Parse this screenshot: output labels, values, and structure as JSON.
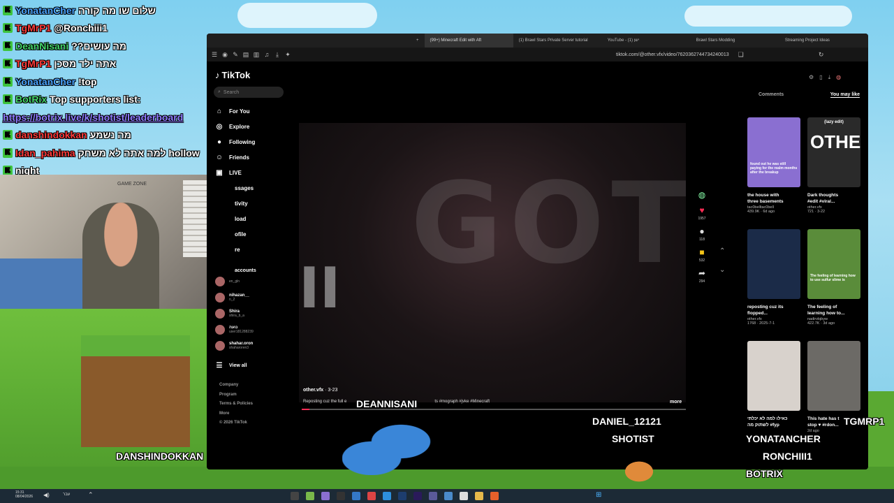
{
  "chat": [
    {
      "user": "YonatanCher",
      "user_color": "#4aa3ff",
      "msg": "שלום שו מה קורה",
      "link": ""
    },
    {
      "user": "TgMrP1",
      "user_color": "#ff3b3b",
      "msg": "@Ronchiii1",
      "link": ""
    },
    {
      "user": "DeanNisani",
      "user_color": "#44d46a",
      "msg": "??מה עושים",
      "link": ""
    },
    {
      "user": "TgMrP1",
      "user_color": "#ff3b3b",
      "msg": "אתה ילד מסכן",
      "link": ""
    },
    {
      "user": "YonatanCher",
      "user_color": "#4aa3ff",
      "msg": "!top",
      "link": ""
    },
    {
      "user": "BotRix",
      "user_color": "#44d46a",
      "msg": "Top supporters list:",
      "link": ""
    },
    {
      "user": "",
      "user_color": "#8f7cff",
      "msg": "",
      "link": "https://botrix.live/k/shotist/leaderboard"
    },
    {
      "user": "danshindokkan",
      "user_color": "#ff3b3b",
      "msg": "מה נשמע",
      "link": ""
    },
    {
      "user": "Idan_pahima",
      "user_color": "#ff3b3b",
      "msg": "למה אתה לא משחק hollow",
      "link": ""
    },
    {
      "user": "night",
      "user_color": "#ffffff",
      "msg": "",
      "link": ""
    }
  ],
  "webcam": {
    "wall_sign": "GAME ZONE"
  },
  "browser": {
    "tabs": [
      {
        "label": "(99+) Minecraft Edit with Aft",
        "active": true
      },
      {
        "label": "(1) Brawl Stars Private Server tutorial",
        "active": false
      },
      {
        "label": "YouTube - ישן (1)",
        "active": false
      },
      {
        "label": "Brawl Stars Modding",
        "active": false
      },
      {
        "label": "Streaming Project Ideas",
        "active": false
      }
    ],
    "url": "tiktok.com/@other.vfx/video/7620362744734240013"
  },
  "tiktok": {
    "logo": "TikTok",
    "search_placeholder": "Search",
    "nav": [
      {
        "label": "For You",
        "icon": "home-icon",
        "glyph": "⌂"
      },
      {
        "label": "Explore",
        "icon": "compass-icon",
        "glyph": "◎"
      },
      {
        "label": "Following",
        "icon": "following-icon",
        "glyph": "●"
      },
      {
        "label": "Friends",
        "icon": "friends-icon",
        "glyph": "☺"
      },
      {
        "label": "LIVE",
        "icon": "live-icon",
        "glyph": "▣"
      },
      {
        "label": "ssages",
        "icon": "messages-icon",
        "glyph": ""
      },
      {
        "label": "tivity",
        "icon": "activity-icon",
        "glyph": ""
      },
      {
        "label": "load",
        "icon": "upload-icon",
        "glyph": ""
      },
      {
        "label": "ofile",
        "icon": "profile-icon",
        "glyph": ""
      },
      {
        "label": "re",
        "icon": "more-icon",
        "glyph": ""
      }
    ],
    "following_accounts_header": "accounts",
    "accounts": [
      {
        "name": "",
        "handle": "en_gln"
      },
      {
        "name": "nihazan__",
        "handle": "n_2"
      },
      {
        "name": "Shira",
        "handle": "shira_b_a"
      },
      {
        "name": "נועה",
        "handle": "user181288239"
      },
      {
        "name": "shahar.oron",
        "handle": "shaharoren3"
      }
    ],
    "view_all": "View all",
    "footer": [
      "Company",
      "Program",
      "Terms & Policies",
      "More",
      "© 2026 TikTok"
    ],
    "video": {
      "author": "other.vfx",
      "date": "3-23",
      "caption_start": "Reposting cuz the full e",
      "caption_end": "ts #mograph #jvke #Minecraft",
      "more": "more",
      "big_text": "GOT",
      "side_text": "II",
      "progress": 0.02
    },
    "actions": [
      {
        "icon": "like-icon",
        "glyph": "♥",
        "count": "1957",
        "color": "#fe2c55"
      },
      {
        "icon": "comment-icon",
        "glyph": "●",
        "count": "118",
        "color": "#dddddd"
      },
      {
        "icon": "bookmark-icon",
        "glyph": "■",
        "count": "532",
        "color": "#f5c518"
      },
      {
        "icon": "share-icon",
        "glyph": "➦",
        "count": "294",
        "color": "#dddddd"
      }
    ],
    "right_tabs": [
      "Comments",
      "You may like"
    ],
    "cards": [
      {
        "title": "the house with\nthree basements",
        "author": "tac0belltac0bell",
        "stats": "439.9K · 6d ago",
        "thumb_text": "found out he was still paying for the realm months after the breakup",
        "bg": "#8a6fd1"
      },
      {
        "title": "Dark thoughts\n#edit #viral...",
        "author": "other.vfx",
        "stats": "721 · 3-22",
        "thumb_text": "OTHER",
        "bg": "#2a2a2a"
      },
      {
        "title": "reposting cuz its\nflopped...",
        "author": "other.vfx",
        "stats": "1768 · 2025-7-1",
        "thumb_text": "",
        "bg": "#1b2b48"
      },
      {
        "title": "The feeling of\nlearning how to...",
        "author": "nadirvlqbyw",
        "stats": "422.7K · 3d ago",
        "thumb_text": "The feeling of learning how to use sulfur slime is",
        "bg": "#5a8c3a"
      },
      {
        "title": "כאילו למה לא יכלתי\nלשתוק מה #fyp",
        "author": "",
        "stats": "",
        "thumb_text": "",
        "bg": "#d8d2cc"
      },
      {
        "title": "This hate has t\nstop ♥ #rdon...",
        "author": "",
        "stats": "2d ago",
        "thumb_text": "",
        "bg": "#6c6a66"
      }
    ],
    "thumb_lazy": "(lazy edit)"
  },
  "overlay_names": {
    "deannisani": "DEANNISANI",
    "daniel": "DANIEL_12121",
    "shotist": "SHOTIST",
    "tgmrp1": "TGMRP1",
    "yonatancher": "YONATANCHER",
    "ronchiii1": "RONCHIII1",
    "botrix": "BOTRIX",
    "danshindokkan": "DANSHINDOKKAN"
  },
  "taskbar": {
    "time": "15:31",
    "date": "08/04/2026",
    "lang": "עבר"
  }
}
